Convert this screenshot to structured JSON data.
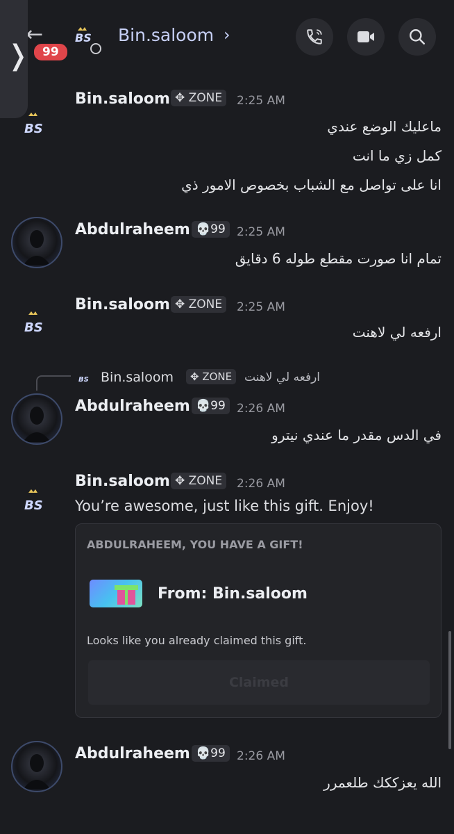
{
  "header": {
    "back_label": "←",
    "unread_count": "99",
    "title": "Bin.saloom",
    "title_chevron": "›",
    "side_tab_chevron": "❭",
    "icons": [
      "phone-icon",
      "video-icon",
      "search-icon"
    ]
  },
  "messages": [
    {
      "author": "Bin.saloom",
      "tag": "✥ ZONE",
      "time": "2:25 AM",
      "lines": [
        "ماعليك الوضع عندي",
        "كمل زي ما انت",
        "انا على تواصل مع الشباب بخصوص الامور ذي"
      ]
    },
    {
      "author": "Abdulraheem",
      "tag": "💀99",
      "time": "2:25 AM",
      "lines": [
        "تمام انا صورت مقطع طوله 6 دقايق"
      ]
    },
    {
      "author": "Bin.saloom",
      "tag": "✥ ZONE",
      "time": "2:25 AM",
      "lines": [
        "ارفعه لي لاهنت"
      ]
    },
    {
      "author": "Abdulraheem",
      "tag": "💀99",
      "time": "2:26 AM",
      "lines": [
        "في الدس مقدر ما عندي نيترو"
      ],
      "reply": {
        "author": "Bin.saloom",
        "tag": "✥ ZONE",
        "text": "ارفعه لي لاهنت"
      }
    },
    {
      "author": "Bin.saloom",
      "tag": "✥ ZONE",
      "time": "2:26 AM",
      "lines": [
        "You’re awesome, just like this gift. Enjoy!"
      ]
    },
    {
      "author": "Abdulraheem",
      "tag": "💀99",
      "time": "2:26 AM",
      "lines": [
        "الله يعزككك طلعمرر"
      ]
    }
  ],
  "gift": {
    "heading": "ABDULRAHEEM, YOU HAVE A GIFT!",
    "from": "From: Bin.saloom",
    "note": "Looks like you already claimed this gift.",
    "button": "Claimed"
  },
  "colors": {
    "background": "#1b1c20",
    "title": "#c7d0f6",
    "badge": "#e0454a"
  }
}
